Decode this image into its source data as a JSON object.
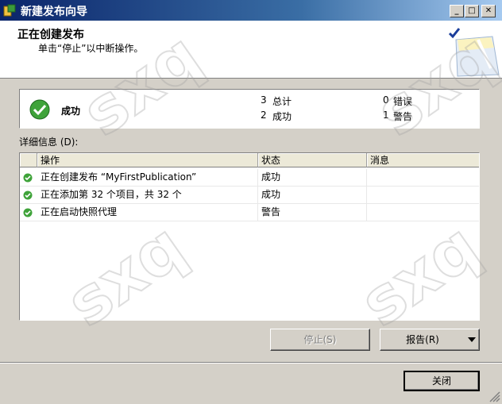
{
  "window": {
    "title": "新建发布向导",
    "controls": {
      "minimize": "_",
      "maximize": "□",
      "close": "✕"
    }
  },
  "header": {
    "title": "正在创建发布",
    "subtitle": "单击“停止”以中断操作。"
  },
  "summary": {
    "status": "成功",
    "total_count": "3",
    "total_label": "总计",
    "success_count": "2",
    "success_label": "成功",
    "error_count": "0",
    "error_label": "错误",
    "warning_count": "1",
    "warning_label": "警告"
  },
  "details_label": "详细信息 (D):",
  "grid": {
    "columns": [
      "操作",
      "状态",
      "消息"
    ],
    "rows": [
      {
        "action": "正在创建发布 “MyFirstPublication”",
        "status": "成功",
        "message": ""
      },
      {
        "action": "正在添加第 32 个项目，共 32 个",
        "status": "成功",
        "message": ""
      },
      {
        "action": "正在启动快照代理",
        "status": "警告",
        "message": ""
      }
    ]
  },
  "buttons": {
    "stop": "停止(S)",
    "report": "报告(R)",
    "close": "关闭"
  },
  "watermark": "sxq",
  "colors": {
    "success": "#3fa33a",
    "titlebar": "#0a246a"
  }
}
